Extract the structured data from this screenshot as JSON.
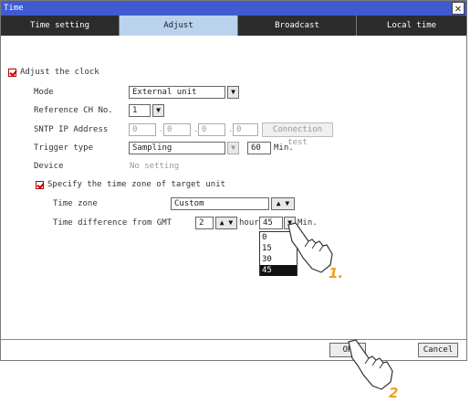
{
  "window": {
    "title": "Time",
    "close_glyph": "✕"
  },
  "tabs": [
    {
      "label": "Time setting",
      "active": false
    },
    {
      "label": "Adjust",
      "active": true
    },
    {
      "label": "Broadcast",
      "active": false
    },
    {
      "label": "Local time",
      "active": false
    }
  ],
  "adjust_clock": {
    "label": "Adjust the clock",
    "checked": true
  },
  "mode": {
    "label": "Mode",
    "value": "External unit"
  },
  "reference_ch": {
    "label": "Reference CH No.",
    "value": "1"
  },
  "sntp": {
    "label": "SNTP IP Address",
    "octets": [
      "0",
      "0",
      "0",
      "0"
    ],
    "connection_test": "Connection test",
    "dot": "."
  },
  "trigger": {
    "label": "Trigger type",
    "value": "Sampling",
    "interval": "60",
    "unit": "Min."
  },
  "device": {
    "label": "Device",
    "value": "No setting"
  },
  "specify_zone": {
    "label": "Specify the time zone of target unit",
    "checked": true
  },
  "time_zone": {
    "label": "Time zone",
    "value": "Custom"
  },
  "gmt_diff": {
    "label": "Time difference from GMT",
    "hours": "2",
    "hour_unit": "hour",
    "minutes": "45",
    "min_unit": "Min."
  },
  "minute_options": [
    "0",
    "15",
    "30",
    "45"
  ],
  "selected_minute_option": "45",
  "footer": {
    "ok": "OK",
    "cancel": "Cancel"
  },
  "callouts": {
    "step1": "1.",
    "step2": "2"
  },
  "colors": {
    "titlebar": "#3f5bd2",
    "tab_active": "#b9d2ee",
    "tab_inactive": "#2c2c2c",
    "check": "#c00000",
    "callout": "#f0a020"
  }
}
